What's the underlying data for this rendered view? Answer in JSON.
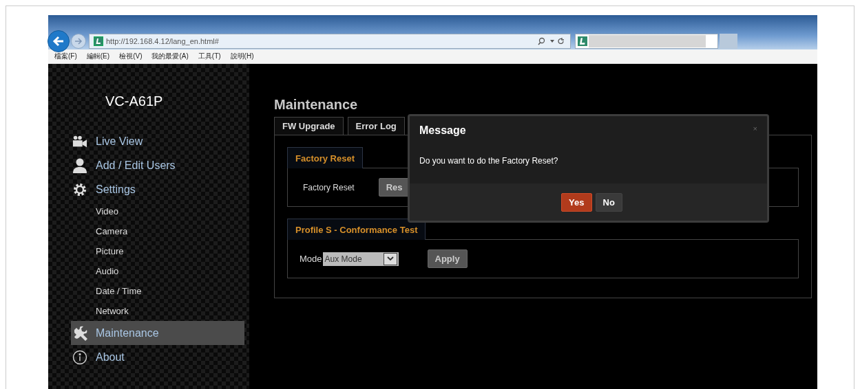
{
  "browser": {
    "url": "http://192.168.4.12/lang_en.html#",
    "menu": [
      "檔案(F)",
      "編輯(E)",
      "檢視(V)",
      "我的最愛(A)",
      "工具(T)",
      "說明(H)"
    ]
  },
  "sidebar": {
    "model": "VC-A61P",
    "items": [
      {
        "label": "Live View",
        "kind": "main",
        "selected": false
      },
      {
        "label": "Add / Edit Users",
        "kind": "main",
        "selected": false
      },
      {
        "label": "Settings",
        "kind": "main",
        "selected": false
      },
      {
        "label": "Video",
        "kind": "sub",
        "selected": false
      },
      {
        "label": "Camera",
        "kind": "sub",
        "selected": false
      },
      {
        "label": "Picture",
        "kind": "sub",
        "selected": false
      },
      {
        "label": "Audio",
        "kind": "sub",
        "selected": false
      },
      {
        "label": "Date / Time",
        "kind": "sub",
        "selected": false
      },
      {
        "label": "Network",
        "kind": "sub",
        "selected": false
      },
      {
        "label": "Maintenance",
        "kind": "main",
        "selected": true
      },
      {
        "label": "About",
        "kind": "main",
        "selected": false
      }
    ]
  },
  "main": {
    "title": "Maintenance",
    "tabs": [
      {
        "label": "FW Upgrade",
        "selected": false
      },
      {
        "label": "Error Log",
        "selected": false
      }
    ],
    "factory_reset": {
      "title": "Factory Reset",
      "label": "Factory Reset",
      "button": "Res"
    },
    "conformance": {
      "title": "Profile S - Conformance Test",
      "mode_label": "Mode",
      "mode_value": "Aux Mode",
      "apply": "Apply"
    }
  },
  "dialog": {
    "title": "Message",
    "close": "×",
    "message": "Do you want to do the Factory Reset?",
    "buttons": [
      {
        "label": "Yes",
        "kind": "primary"
      },
      {
        "label": "No",
        "kind": "secondary"
      }
    ]
  }
}
